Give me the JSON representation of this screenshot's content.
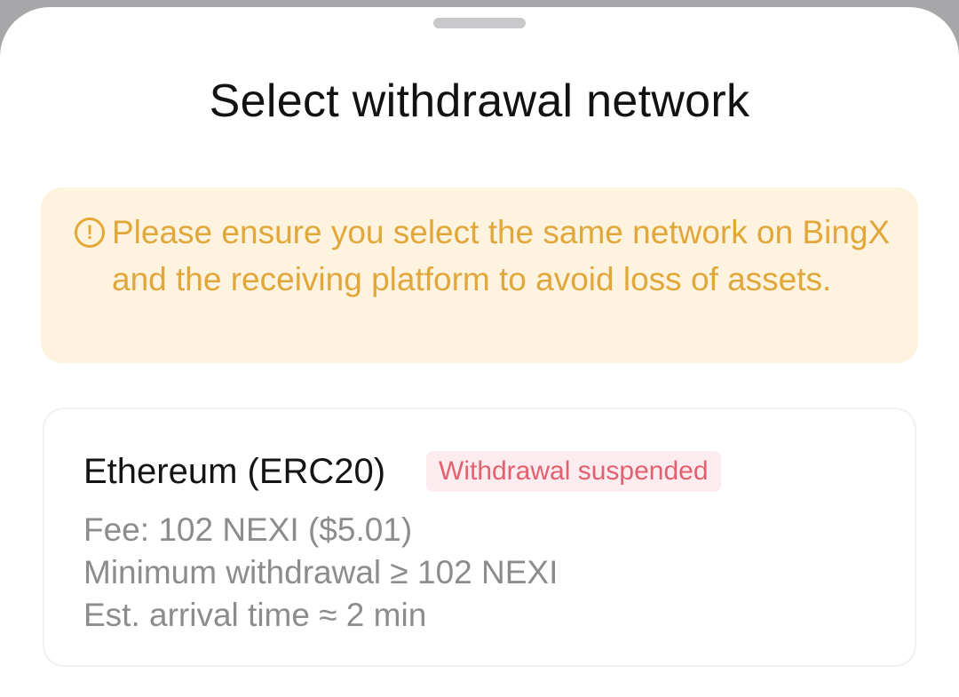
{
  "sheet": {
    "title": "Select withdrawal network"
  },
  "notice": {
    "icon": "exclamation-circle-icon",
    "text": "Please ensure you select the same network on BingX and the receiving platform to avoid loss of assets."
  },
  "networks": [
    {
      "name": "Ethereum (ERC20)",
      "status": "Withdrawal suspended",
      "fee": "Fee: 102 NEXI ($5.01)",
      "minimum": "Minimum withdrawal ≥ 102 NEXI",
      "arrival": "Est. arrival time ≈ 2 min"
    }
  ],
  "colors": {
    "notice_background": "#fdf3de",
    "notice_text": "#e2a73a",
    "suspended_background": "#fcebef",
    "suspended_text": "#e3606f"
  }
}
